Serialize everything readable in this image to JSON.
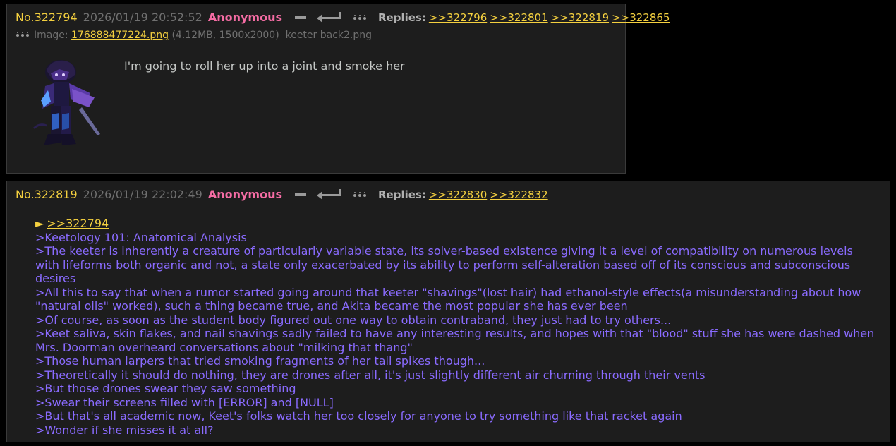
{
  "posts": [
    {
      "number": "No.322794",
      "datetime": "2026/01/19 20:52:52",
      "name": "Anonymous",
      "replies_label": "Replies:",
      "replies": [
        ">>322796",
        ">>322801",
        ">>322819",
        ">>322865"
      ],
      "file": {
        "prefix": "Image:",
        "filename": "176888477224.png",
        "meta": "(4.12MB, 1500x2000)",
        "original_name": "keeter back2.png"
      },
      "comment": "I'm going to roll her up into a joint and smoke her"
    },
    {
      "number": "No.322819",
      "datetime": "2026/01/19 22:02:49",
      "name": "Anonymous",
      "replies_label": "Replies:",
      "replies": [
        ">>322830",
        ">>322832"
      ],
      "backlink_arrow": "►",
      "backlink": ">>322794",
      "lines": [
        ">Keetology 101: Anatomical Analysis",
        ">The keeter is inherently a creature of particularly variable state, its solver-based existence giving it a level of compatibility on numerous levels with lifeforms both organic and not, a state only exacerbated by its ability to perform self-alteration based off of its conscious and subconscious desires",
        ">All this to say that when a rumor started going around that keeter \"shavings\"(lost hair) had ethanol-style effects(a misunderstanding about how \"natural oils\" worked), such a thing became true, and Akita became the most popular she has ever been",
        ">Of course, as soon as the student body figured out one way to obtain contraband, they just had to try others...",
        ">Keet saliva, skin flakes, and nail shavings sadly failed to have any interesting results, and hopes with that \"blood\" stuff she has were dashed when Mrs. Doorman overheard conversations about \"milking that thang\"",
        ">Those human larpers that tried smoking fragments of her tail spikes though...",
        ">Theoretically it should do nothing, they are drones after all, it's just slightly different air churning through their vents",
        ">But those drones swear they saw something",
        ">Swear their screens filled with [ERROR] and [NULL]",
        ">But that's all academic now, Keet's folks watch her too closely for anyone to try something like that racket again",
        ">Wonder if she misses it at all?"
      ]
    }
  ],
  "colors": {
    "background": "#000000",
    "post_bg": "#1d1d1d",
    "post_number": "#f4d03f",
    "name": "#f56ca4",
    "link": "#f4d03f",
    "quote": "#8a6bff",
    "text": "#c5c8c6"
  },
  "icons": [
    "minus-icon",
    "reply-arrow-icon",
    "menu-dots-icon"
  ]
}
